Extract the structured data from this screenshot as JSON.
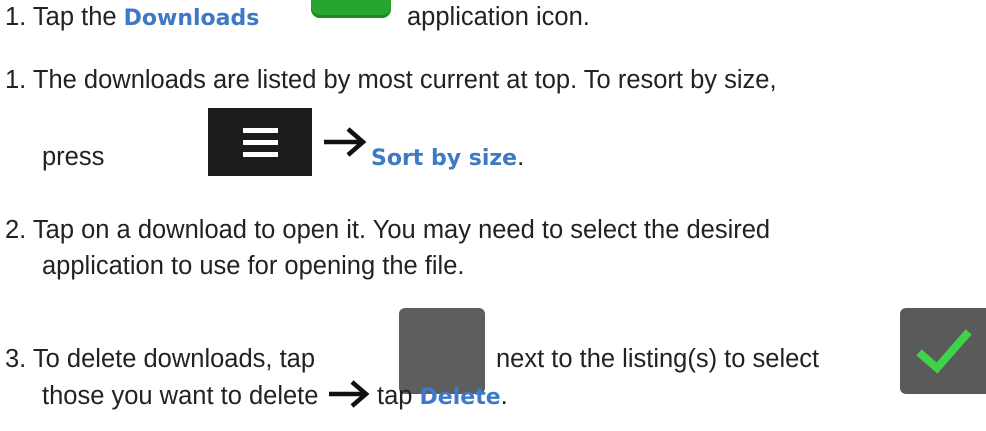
{
  "steps": [
    {
      "number": "1.",
      "before": "Tap the",
      "highlight": "Downloads",
      "after": "application icon."
    },
    {
      "number": "1.",
      "line1": "The downloads are listed by most current at top. To resort by size,",
      "before": "press",
      "highlight": "Sort by size",
      "after": "."
    },
    {
      "number": "2.",
      "line1": "Tap on a download to open it. You may need to select the desired",
      "line2": "application to use for opening the file."
    },
    {
      "number": "3.",
      "before": "To delete downloads, tap",
      "middle": "next to the listing(s) to select",
      "line2_before": "those you want to delete",
      "line2_after": "tap",
      "highlight": "Delete",
      "after": "."
    }
  ],
  "colors": {
    "highlight": "#3d79c4",
    "downloads_icon": "#27a52e",
    "menu_icon": "#1c1c1c",
    "checkbox": "#5e5e5e",
    "checkmark": "#3fd24b"
  },
  "icons": [
    "downloads-app-icon",
    "menu-icon",
    "arrow-right-icon",
    "checkbox-unchecked-icon",
    "checkbox-checked-icon"
  ]
}
